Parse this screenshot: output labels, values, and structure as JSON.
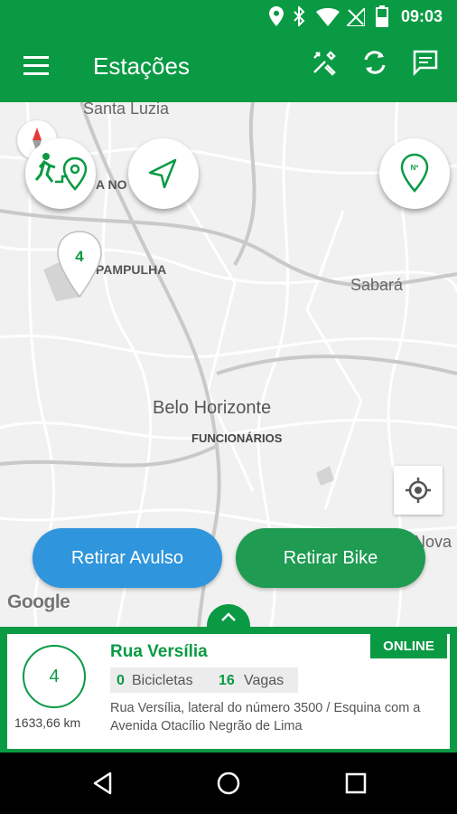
{
  "status_bar": {
    "time": "09:03",
    "icons": [
      "location-icon",
      "bluetooth-icon",
      "wifi-icon",
      "no-signal-icon",
      "battery-icon"
    ]
  },
  "app_bar": {
    "title": "Estações",
    "menu_icon": "menu-icon",
    "actions": [
      "tools-icon",
      "refresh-icon",
      "message-icon"
    ]
  },
  "map": {
    "labels": {
      "santa_luzia": "Santa Luzia",
      "a_no": "A NO",
      "pampulha": "PAMPULHA",
      "sabara": "Sabará",
      "belo_horizonte": "Belo Horizonte",
      "funcionarios": "FUNCIONÁRIOS",
      "nova": "Nova"
    },
    "marker_count": "4",
    "google": "Google",
    "fabs": [
      "walk-to-location-icon",
      "navigate-icon",
      "station-number-pin-icon"
    ]
  },
  "buttons": {
    "retirar_avulso": "Retirar Avulso",
    "retirar_bike": "Retirar Bike"
  },
  "station": {
    "number": "4",
    "distance": "1633,66 km",
    "name": "Rua Versília",
    "status": "ONLINE",
    "bikes_count": "0",
    "bikes_label": "Bicicletas",
    "slots_count": "16",
    "slots_label": "Vagas",
    "address": "Rua Versília, lateral do número 3500 / Esquina com a Avenida Otacílio Negrão de Lima"
  },
  "colors": {
    "primary": "#0a9a44",
    "blue_button": "#2f95dc",
    "green_button": "#1f9b52"
  }
}
